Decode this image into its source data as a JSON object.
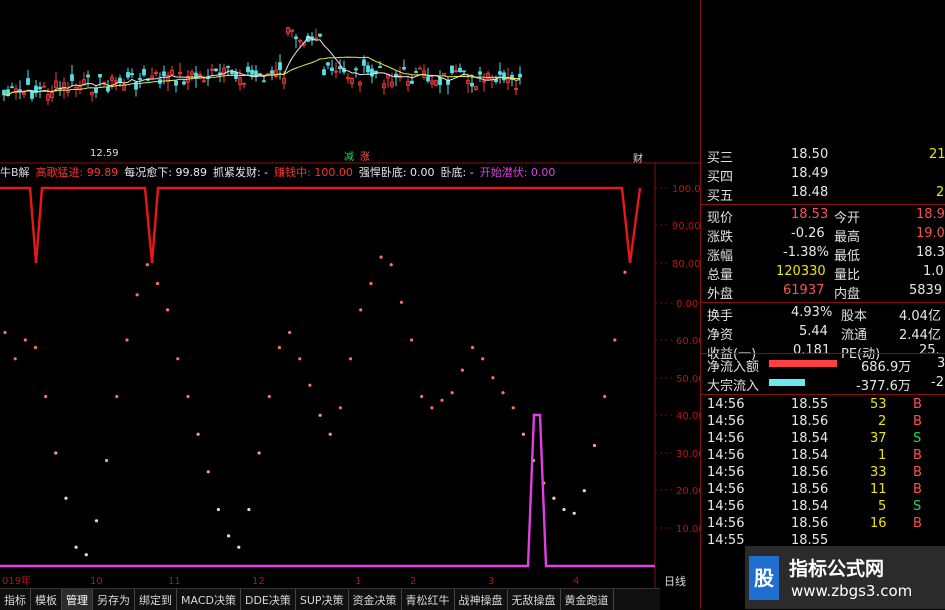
{
  "main_chart": {
    "low_price_label": "12.59",
    "signal_green": "减",
    "signal_red": "涨",
    "signal_right": "财"
  },
  "indicator_header": {
    "name": "牛B解",
    "items": [
      {
        "text": "高歌猛进: 99.89",
        "color": "#ff3030"
      },
      {
        "text": "每况愈下: 99.89",
        "color": "#e8e8e8"
      },
      {
        "text": "抓紧发财: -",
        "color": "#e8e8e8"
      },
      {
        "text": "赚钱中: 100.00",
        "color": "#ff3030"
      },
      {
        "text": "强悍卧底: 0.00",
        "color": "#e8e8e8"
      },
      {
        "text": "卧底: -",
        "color": "#e8e8e8"
      },
      {
        "text": "开始潜伏: 0.00",
        "color": "#e040e0"
      }
    ]
  },
  "chart_data": {
    "type": "line",
    "upper_pane": {
      "yticks": [
        "100.0",
        "90.00",
        "80.00"
      ],
      "series": [
        {
          "name": "赚钱中",
          "values": [
            100,
            100,
            80,
            100,
            100,
            80,
            100,
            100,
            100,
            80,
            100
          ]
        }
      ]
    },
    "lower_pane": {
      "yticks": [
        "0.00",
        "60.00",
        "50.00",
        "40.00",
        "30.00",
        "20.00",
        "10.00"
      ],
      "x_labels": [
        "019年",
        "10",
        "11",
        "12",
        "1",
        "2",
        "3",
        "4"
      ],
      "dots": [
        62,
        55,
        60,
        58,
        45,
        30,
        18,
        5,
        3,
        12,
        28,
        45,
        60,
        72,
        80,
        75,
        68,
        55,
        45,
        35,
        25,
        15,
        8,
        5,
        15,
        30,
        45,
        58,
        62,
        55,
        48,
        40,
        35,
        42,
        55,
        68,
        75,
        82,
        80,
        70,
        60,
        45,
        42,
        44,
        46,
        52,
        58,
        55,
        50,
        46,
        42,
        35,
        28,
        22,
        18,
        15,
        14,
        20,
        32,
        45,
        60,
        78
      ]
    }
  },
  "quote": {
    "asks": [
      {
        "label": "买三",
        "price": "18.50",
        "vol": "21"
      },
      {
        "label": "买四",
        "price": "18.49",
        "vol": ""
      },
      {
        "label": "买五",
        "price": "18.48",
        "vol": "2"
      }
    ],
    "stats": [
      {
        "l1": "现价",
        "v1": "18.53",
        "c1": "red",
        "l2": "今开",
        "v2": "18.9",
        "c2": "red"
      },
      {
        "l1": "涨跌",
        "v1": "-0.26",
        "c1": "white",
        "l2": "最高",
        "v2": "19.0",
        "c2": "red"
      },
      {
        "l1": "涨幅",
        "v1": "-1.38%",
        "c1": "white",
        "l2": "最低",
        "v2": "18.3",
        "c2": "white"
      },
      {
        "l1": "总量",
        "v1": "120330",
        "c1": "yellow",
        "l2": "量比",
        "v2": "1.0",
        "c2": "white"
      },
      {
        "l1": "外盘",
        "v1": "61937",
        "c1": "red",
        "l2": "内盘",
        "v2": "5839",
        "c2": "white"
      }
    ],
    "fund": [
      {
        "l1": "换手",
        "v1": "4.93%",
        "l2": "股本",
        "v2": "4.04亿"
      },
      {
        "l1": "净资",
        "v1": "5.44",
        "l2": "流通",
        "v2": "2.44亿"
      },
      {
        "l1": "收益(一)",
        "v1": "0.181",
        "l2": "PE(动)",
        "v2": "25."
      }
    ],
    "flows": [
      {
        "label": "净流入额",
        "value": "686.9万",
        "pct": "3",
        "bar_color": "#ff4040",
        "bar_frac": 0.75
      },
      {
        "label": "大宗流入",
        "value": "-377.6万",
        "pct": "-2",
        "bar_color": "#6ee8f0",
        "bar_frac": 0.4
      }
    ],
    "ticks": [
      {
        "time": "14:56",
        "price": "18.55",
        "vol": "53",
        "side": "B"
      },
      {
        "time": "14:56",
        "price": "18.56",
        "vol": "2",
        "side": "B"
      },
      {
        "time": "14:56",
        "price": "18.54",
        "vol": "37",
        "side": "S"
      },
      {
        "time": "14:56",
        "price": "18.54",
        "vol": "1",
        "side": "B"
      },
      {
        "time": "14:56",
        "price": "18.56",
        "vol": "33",
        "side": "B"
      },
      {
        "time": "14:56",
        "price": "18.56",
        "vol": "11",
        "side": "B"
      },
      {
        "time": "14:56",
        "price": "18.54",
        "vol": "5",
        "side": "S"
      },
      {
        "time": "14:56",
        "price": "18.56",
        "vol": "16",
        "side": "B"
      },
      {
        "time": "14:55",
        "price": "18.55",
        "vol": "",
        "side": ""
      }
    ]
  },
  "period": "日线",
  "tabs": [
    "指标",
    "模板",
    "管理",
    "另存为",
    "绑定到",
    "MACD决策",
    "DDE决策",
    "SUP决策",
    "资金决策",
    "青松红牛",
    "战神操盘",
    "无敌操盘",
    "黄金跑道"
  ],
  "active_tab": "管理",
  "watermark": {
    "logo": "股",
    "title": "指标公式网",
    "url": "www.zbgs3.com"
  }
}
